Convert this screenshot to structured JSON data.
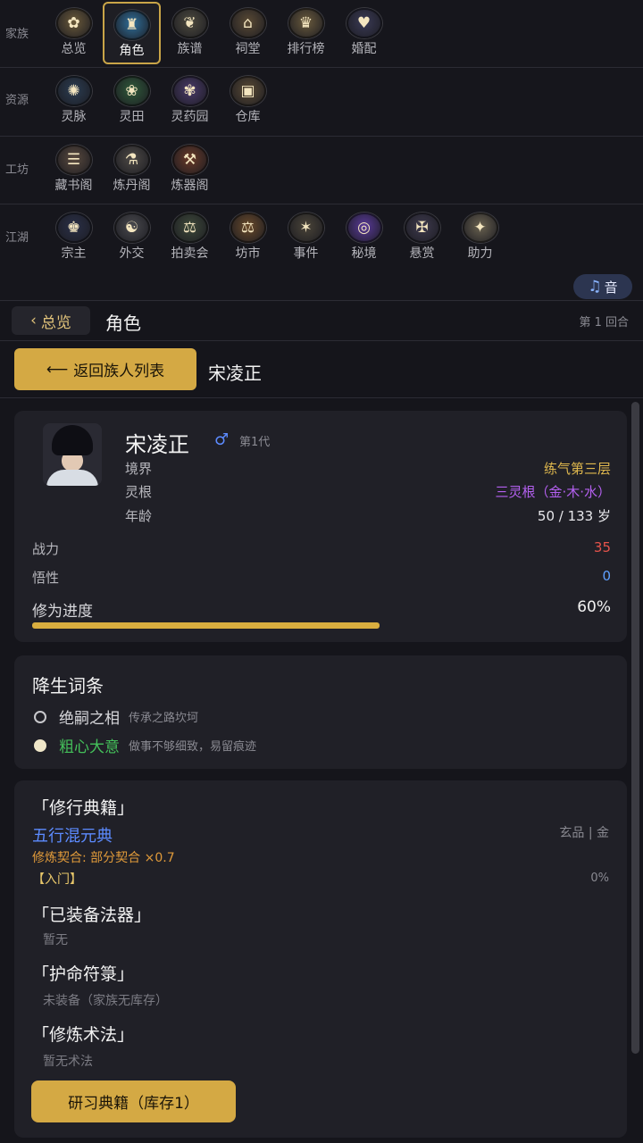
{
  "nav": {
    "rows": [
      {
        "category": "家族",
        "items": [
          {
            "label": "总览",
            "icon": "overview-icon",
            "glyph": "✿",
            "color": "#6b5a3a"
          },
          {
            "label": "角色",
            "icon": "character-icon",
            "glyph": "♜",
            "color": "#2f6f9a",
            "active": true
          },
          {
            "label": "族谱",
            "icon": "family-tree-icon",
            "glyph": "❦",
            "color": "#4d4a3e"
          },
          {
            "label": "祠堂",
            "icon": "shrine-icon",
            "glyph": "⌂",
            "color": "#5a4a34"
          },
          {
            "label": "排行榜",
            "icon": "ranking-icon",
            "glyph": "♛",
            "color": "#6a5a3c"
          },
          {
            "label": "婚配",
            "icon": "marriage-icon",
            "glyph": "♥",
            "color": "#3a3a55"
          }
        ]
      },
      {
        "category": "资源",
        "items": [
          {
            "label": "灵脉",
            "icon": "spirit-vein-icon",
            "glyph": "✺",
            "color": "#2b3d52"
          },
          {
            "label": "灵田",
            "icon": "spirit-field-icon",
            "glyph": "❀",
            "color": "#2f5a3a"
          },
          {
            "label": "灵药园",
            "icon": "herb-garden-icon",
            "glyph": "✾",
            "color": "#4a3a6a"
          },
          {
            "label": "仓库",
            "icon": "warehouse-icon",
            "glyph": "▣",
            "color": "#5a4a34"
          }
        ]
      },
      {
        "category": "工坊",
        "items": [
          {
            "label": "藏书阁",
            "icon": "library-icon",
            "glyph": "☰",
            "color": "#5a4a3e"
          },
          {
            "label": "炼丹阁",
            "icon": "alchemy-icon",
            "glyph": "⚗",
            "color": "#4e4a46"
          },
          {
            "label": "炼器阁",
            "icon": "forge-icon",
            "glyph": "⚒",
            "color": "#6a3a28"
          }
        ]
      },
      {
        "category": "江湖",
        "items": [
          {
            "label": "宗主",
            "icon": "sect-leader-icon",
            "glyph": "♚",
            "color": "#2a3048"
          },
          {
            "label": "外交",
            "icon": "diplomacy-icon",
            "glyph": "☯",
            "color": "#4a4a4e"
          },
          {
            "label": "拍卖会",
            "icon": "auction-icon",
            "glyph": "⚖",
            "color": "#3e4a3a"
          },
          {
            "label": "坊市",
            "icon": "market-icon",
            "glyph": "⚖",
            "color": "#6a4a2a"
          },
          {
            "label": "事件",
            "icon": "event-icon",
            "glyph": "✶",
            "color": "#4a4438"
          },
          {
            "label": "秘境",
            "icon": "secret-realm-icon",
            "glyph": "◎",
            "color": "#5a3a9a"
          },
          {
            "label": "悬赏",
            "icon": "bounty-icon",
            "glyph": "✠",
            "color": "#3e3a4e"
          },
          {
            "label": "助力",
            "icon": "assist-icon",
            "glyph": "✦",
            "color": "#6a6250"
          }
        ]
      }
    ],
    "music_label": "音"
  },
  "header": {
    "back_label": "总览",
    "title": "角色",
    "round": "第 1 回合"
  },
  "sub": {
    "back_label": "返回族人列表",
    "name": "宋凌正"
  },
  "character": {
    "name": "宋凌正",
    "gender_symbol": "♂",
    "generation": "第1代",
    "realm_label": "境界",
    "realm": "练气第三层",
    "root_label": "灵根",
    "root": "三灵根（金·木·水）",
    "age_label": "年龄",
    "age": "50 / 133 岁",
    "power_label": "战力",
    "power": "35",
    "wisdom_label": "悟性",
    "wisdom": "0",
    "progress_label": "修为进度",
    "progress_text": "60%",
    "progress": 0.6
  },
  "traits": {
    "title": "降生词条",
    "items": [
      {
        "name": "绝嗣之相",
        "desc": "传承之路坎坷",
        "filled": false
      },
      {
        "name": "粗心大意",
        "desc": "做事不够细致，易留痕迹",
        "filled": true
      }
    ]
  },
  "cultivation": {
    "manual_section": "「修行典籍」",
    "manual_name": "五行混元典",
    "manual_grade": "玄品 | 金",
    "fit": "修炼契合: 部分契合 ×0.7",
    "stage": "【入门】",
    "stage_pct": "0%",
    "artifact_section": "「已装备法器」",
    "artifact_value": "暂无",
    "talisman_section": "「护命符箓」",
    "talisman_value": "未装备（家族无库存）",
    "technique_section": "「修炼术法」",
    "technique_value": "暂无术法",
    "study_button": "研习典籍（库存1）"
  },
  "colors": {
    "accent": "#d4a944",
    "realm": "#e0b84e",
    "root": "#b460f0",
    "power": "#e5534b",
    "wisdom": "#5fa0ff",
    "trait_good": "#44c05a",
    "manual": "#5c8bff"
  }
}
